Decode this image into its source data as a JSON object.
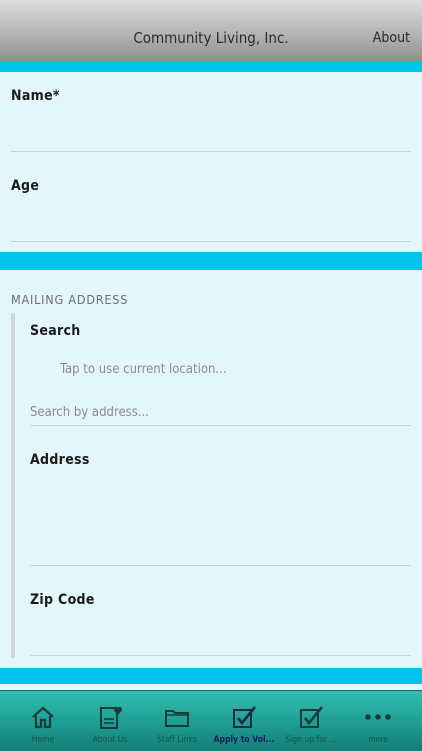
{
  "header": {
    "title": "Community Living, Inc.",
    "about": "About"
  },
  "form": {
    "name_label": "Name*",
    "age_label": "Age",
    "mailing_section": "MAILING ADDRESS",
    "search_label": "Search",
    "location_hint": "Tap to use current location...",
    "search_placeholder": "Search by address...",
    "address_label": "Address",
    "zip_label": "Zip Code"
  },
  "tabs": [
    {
      "label": "Home",
      "icon": "home-icon"
    },
    {
      "label": "About Us",
      "icon": "document-heart-icon"
    },
    {
      "label": "Staff Links",
      "icon": "folder-icon"
    },
    {
      "label": "Apply to Vol...",
      "icon": "checkbox-icon",
      "active": true
    },
    {
      "label": "Sign up for ...",
      "icon": "checkbox-icon"
    },
    {
      "label": "more",
      "icon": "more-dots-icon"
    }
  ],
  "colors": {
    "accent_bar": "#00c3ee",
    "background": "#e3f6fc",
    "tabbar": "#1c9a8f"
  }
}
